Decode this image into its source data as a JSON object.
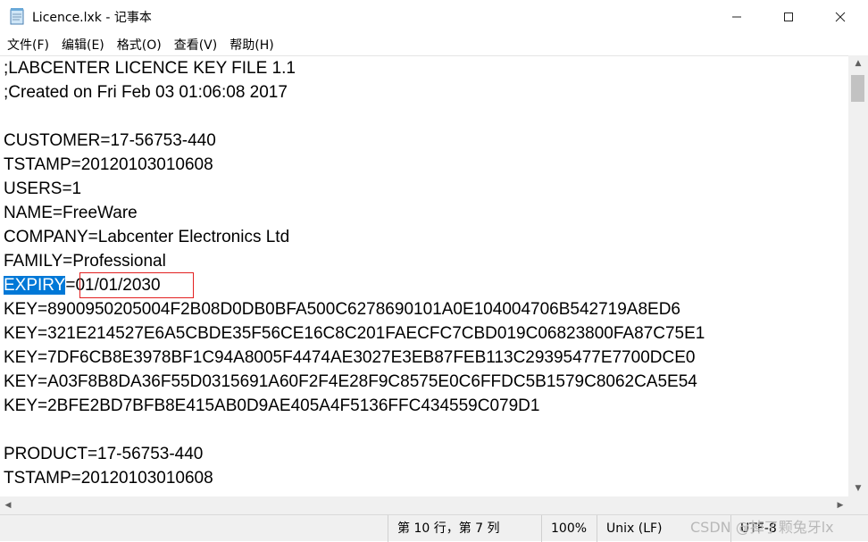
{
  "window": {
    "title": "Licence.lxk - 记事本",
    "icon": "notepad-icon",
    "controls": {
      "minimize": "—",
      "maximize": "☐",
      "close": "✕"
    }
  },
  "menu": {
    "items": [
      "文件(F)",
      "编辑(E)",
      "格式(O)",
      "查看(V)",
      "帮助(H)"
    ]
  },
  "editor": {
    "lines": [
      ";LABCENTER LICENCE KEY FILE 1.1",
      ";Created on Fri Feb 03 01:06:08 2017",
      "",
      "CUSTOMER=17-56753-440",
      "TSTAMP=20120103010608",
      "USERS=1",
      "NAME=FreeWare",
      "COMPANY=Labcenter Electronics Ltd",
      "FAMILY=Professional",
      "",
      "KEY=8900950205004F2B08D0DB0BFA500C6278690101A0E104004706B542719A8ED6",
      "KEY=321E214527E6A5CBDE35F56CE16C8C201FAECFC7CBD019C06823800FA87C75E1",
      "KEY=7DF6CB8E3978BF1C94A8005F4474AE3027E3EB87FEB113C29395477E7700DCE0",
      "KEY=A03F8B8DA36F55D0315691A60F2F4E28F9C8575E0C6FFDC5B1579C8062CA5E54",
      "KEY=2BFE2BD7BFB8E415AB0D9AE405A4F5136FFC434559C079D1",
      "",
      "PRODUCT=17-56753-440",
      "TSTAMP=20120103010608"
    ],
    "expiry": {
      "key": "EXPIRY",
      "separator": "=",
      "value": "01/01/2030"
    },
    "selection_color": "#0078d7",
    "highlight_color": "#e32020"
  },
  "statusbar": {
    "position": "第 10 行，第 7 列",
    "zoom": "100%",
    "line_ending": "Unix (LF)",
    "encoding": "UTF-8"
  },
  "watermark": "CSDN @掉了颗兔牙lx"
}
